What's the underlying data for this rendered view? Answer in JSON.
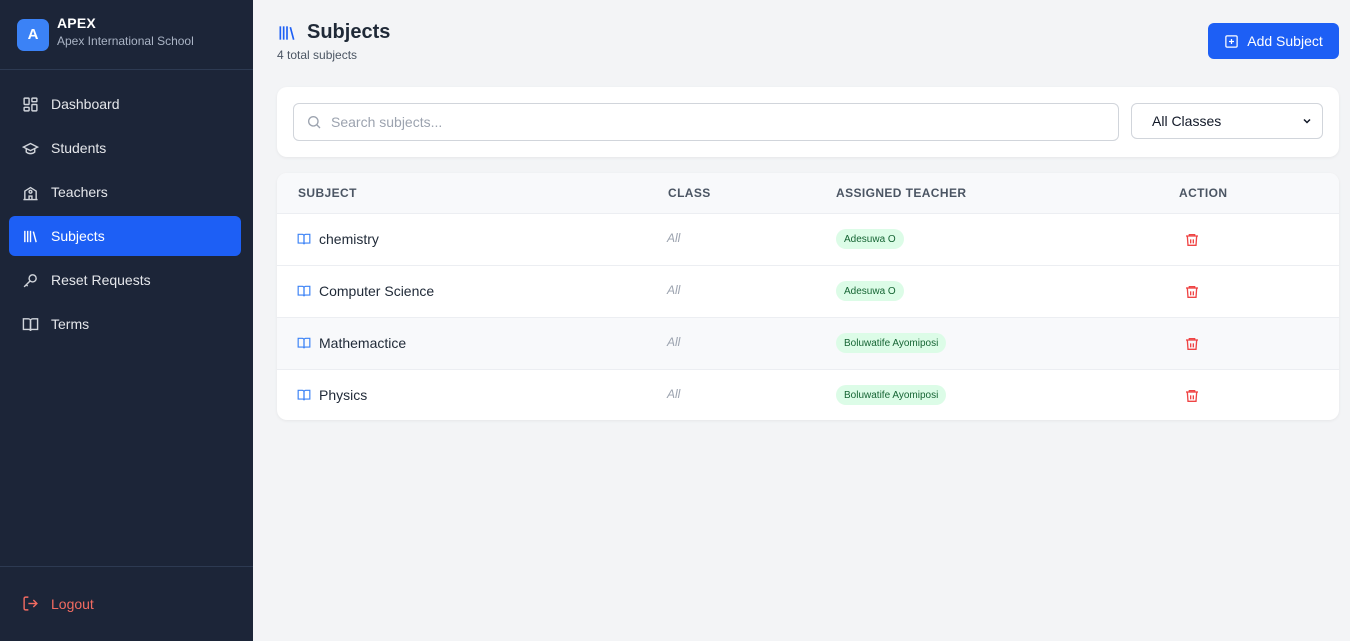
{
  "brand": {
    "logo_letter": "A",
    "name": "APEX",
    "school": "Apex International School"
  },
  "sidebar": {
    "items": [
      {
        "label": "Dashboard",
        "icon": "dashboard-icon"
      },
      {
        "label": "Students",
        "icon": "graduation-cap-icon"
      },
      {
        "label": "Teachers",
        "icon": "school-icon"
      },
      {
        "label": "Subjects",
        "icon": "library-icon",
        "active": true
      },
      {
        "label": "Reset Requests",
        "icon": "key-icon"
      },
      {
        "label": "Terms",
        "icon": "book-open-icon"
      }
    ],
    "logout_label": "Logout"
  },
  "header": {
    "title": "Subjects",
    "subtitle": "4 total subjects",
    "add_button_label": "Add Subject"
  },
  "filters": {
    "search_placeholder": "Search subjects...",
    "class_selected": "All Classes"
  },
  "table": {
    "columns": [
      "SUBJECT",
      "CLASS",
      "ASSIGNED TEACHER",
      "ACTION"
    ],
    "rows": [
      {
        "subject": "chemistry",
        "class": "All",
        "teacher": "Adesuwa O"
      },
      {
        "subject": "Computer Science",
        "class": "All",
        "teacher": "Adesuwa O"
      },
      {
        "subject": "Mathemactice",
        "class": "All",
        "teacher": "Boluwatife Ayomiposi"
      },
      {
        "subject": "Physics",
        "class": "All",
        "teacher": "Boluwatife Ayomiposi"
      }
    ]
  },
  "colors": {
    "primary": "#1d5ff5",
    "sidebar_bg": "#1c2538",
    "danger": "#ef4444",
    "badge_bg": "#dcfce7",
    "badge_text": "#166534"
  }
}
